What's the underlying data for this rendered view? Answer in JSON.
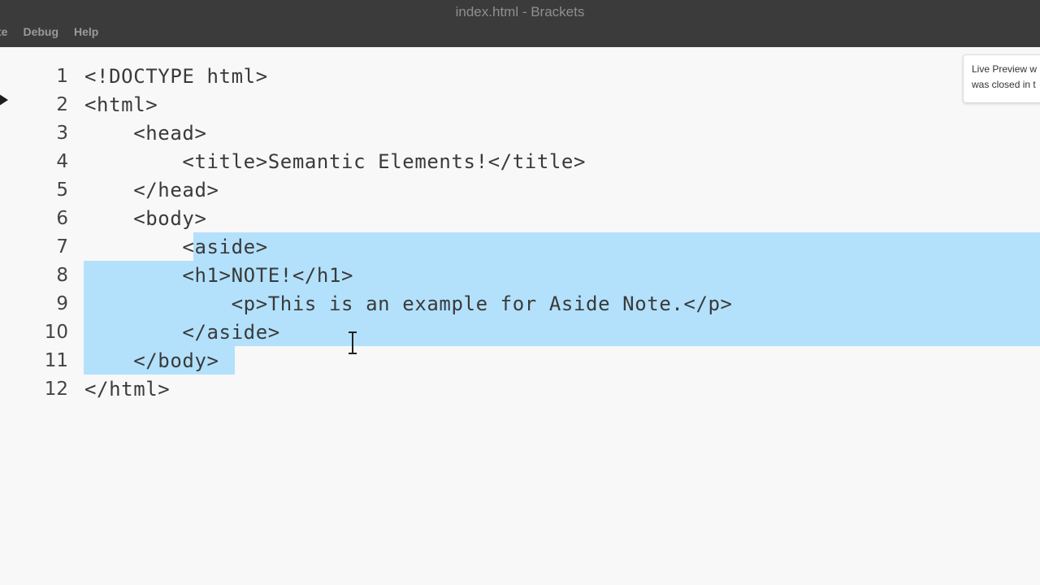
{
  "window": {
    "title": "index.html - Brackets"
  },
  "menu": {
    "items": [
      {
        "label": "te"
      },
      {
        "label": "Debug"
      },
      {
        "label": "Help"
      }
    ]
  },
  "editor": {
    "lines": [
      {
        "num": "1",
        "text": "<!DOCTYPE html>"
      },
      {
        "num": "2",
        "text": "<html>"
      },
      {
        "num": "3",
        "text": "    <head>"
      },
      {
        "num": "4",
        "text": "        <title>Semantic Elements!</title>"
      },
      {
        "num": "5",
        "text": "    </head>"
      },
      {
        "num": "6",
        "text": "    <body>"
      },
      {
        "num": "7",
        "text": "        <aside>"
      },
      {
        "num": "8",
        "text": "        <h1>NOTE!</h1>"
      },
      {
        "num": "9",
        "text": "            <p>This is an example for Aside Note.</p>"
      },
      {
        "num": "10",
        "text": "        </aside>"
      },
      {
        "num": "11",
        "text": "    </body>"
      },
      {
        "num": "12",
        "text": "</html>"
      }
    ],
    "selection_color": "#b3e1fc"
  },
  "notification": {
    "line1": "Live Preview w",
    "line2": "was closed in t"
  }
}
